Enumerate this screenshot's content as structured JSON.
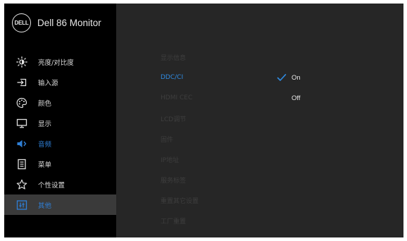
{
  "brand": {
    "logo_text": "DELL",
    "title": "Dell 86 Monitor"
  },
  "nav": {
    "items": [
      {
        "label": "亮度/对比度",
        "icon": "brightness-icon"
      },
      {
        "label": "输入源",
        "icon": "input-source-icon"
      },
      {
        "label": "颜色",
        "icon": "color-palette-icon"
      },
      {
        "label": "显示",
        "icon": "display-icon"
      },
      {
        "label": "音频",
        "icon": "speaker-icon"
      },
      {
        "label": "菜单",
        "icon": "menu-icon"
      },
      {
        "label": "个性设置",
        "icon": "star-icon"
      },
      {
        "label": "其他",
        "icon": "others-icon"
      }
    ],
    "selected": "其他"
  },
  "submenu": {
    "items": [
      "显示信息",
      "DDC/CI",
      "HDMI CEC",
      "LCD调节",
      "固件",
      "IP地址",
      "服务标签",
      "重置其它设置",
      "工厂重置"
    ],
    "active": "DDC/CI"
  },
  "options": {
    "on_label": "On",
    "off_label": "Off",
    "selected": "On"
  },
  "colors": {
    "accent": "#2f7fd6",
    "sidebar_bg": "#000000",
    "panel_bg": "#262626"
  }
}
